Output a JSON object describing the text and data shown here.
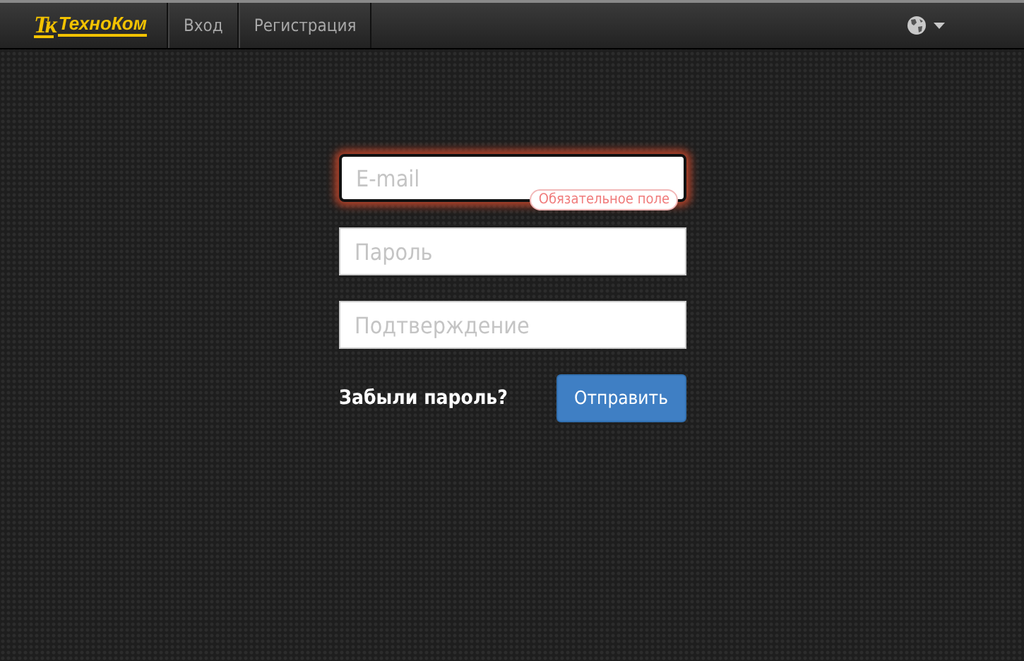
{
  "navbar": {
    "logo_mark": "Тк",
    "logo_text": "ТехноКом",
    "links": [
      {
        "label": "Вход",
        "selected": false
      },
      {
        "label": "Регистрация",
        "selected": false
      }
    ]
  },
  "form": {
    "fields": [
      {
        "placeholder": "E-mail",
        "invalid": true,
        "error": "Обязательное поле"
      },
      {
        "placeholder": "Пароль",
        "invalid": false
      },
      {
        "placeholder": "Подтверждение",
        "invalid": false
      }
    ],
    "forgot_link": "Забыли пароль?",
    "submit": "Отправить"
  }
}
